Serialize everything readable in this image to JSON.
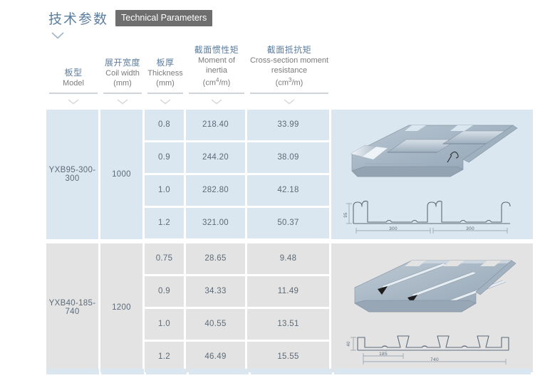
{
  "header": {
    "title_cn": "技术参数",
    "title_badge": "Technical Parameters",
    "expand_icon": "chevron-down-icon"
  },
  "table": {
    "columns": [
      {
        "cn": "板型",
        "en": "Model",
        "unit": ""
      },
      {
        "cn": "展开宽度",
        "en": "Coil width",
        "unit": "(mm)"
      },
      {
        "cn": "板厚",
        "en": "Thickness",
        "unit": "(mm)"
      },
      {
        "cn": "截面惯性矩",
        "en": "Moment of inertia",
        "unit_pre": "(cm",
        "unit_sup": "4",
        "unit_post": "/m)"
      },
      {
        "cn": "截面抵抗矩",
        "en": "Cross-section moment resistance",
        "unit_pre": "(cm",
        "unit_sup": "3",
        "unit_post": "/m)"
      },
      {
        "cn": "",
        "en": "",
        "unit": ""
      }
    ],
    "column_filter_icon": "chevron-down-icon",
    "groups": [
      {
        "model": "YXB95-300-300",
        "coil_width": "1000",
        "theme": "blue",
        "rows": [
          {
            "thickness": "0.8",
            "inertia": "218.40",
            "resistance": "33.99"
          },
          {
            "thickness": "0.9",
            "inertia": "244.20",
            "resistance": "38.09"
          },
          {
            "thickness": "1.0",
            "inertia": "282.80",
            "resistance": "42.18"
          },
          {
            "thickness": "1.2",
            "inertia": "321.00",
            "resistance": "50.37"
          }
        ],
        "figure": {
          "type": "deck-profile-95",
          "height_label": "95",
          "span_labels": [
            "300",
            "300"
          ]
        }
      },
      {
        "model": "YXB40-185-740",
        "coil_width": "1200",
        "theme": "gray",
        "rows": [
          {
            "thickness": "0.75",
            "inertia": "28.65",
            "resistance": "9.48"
          },
          {
            "thickness": "0.9",
            "inertia": "34.33",
            "resistance": "11.49"
          },
          {
            "thickness": "1.0",
            "inertia": "40.55",
            "resistance": "13.51"
          },
          {
            "thickness": "1.2",
            "inertia": "46.49",
            "resistance": "15.55"
          }
        ],
        "figure": {
          "type": "deck-profile-40",
          "height_label": "40",
          "span_labels": [
            "185",
            "740"
          ]
        }
      }
    ]
  },
  "colors": {
    "row_blue": "#dbe7f0",
    "row_gray": "#e3e3e3",
    "header_cn": "#5b7d9e",
    "header_en": "#7b7b7b",
    "badge_bg": "#6e6e6e",
    "cell_text": "#5c6b78"
  }
}
